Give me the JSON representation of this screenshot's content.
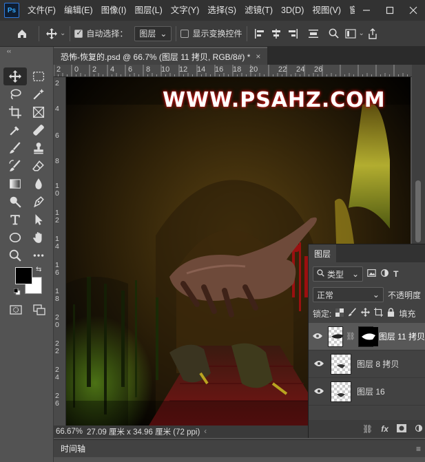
{
  "app": {
    "logo": "Ps"
  },
  "menu": [
    "文件(F)",
    "编辑(E)",
    "图像(I)",
    "图层(L)",
    "文字(Y)",
    "选择(S)",
    "滤镜(T)",
    "3D(D)",
    "视图(V)",
    "窗口"
  ],
  "options": {
    "auto_select_label": "自动选择：",
    "auto_select_target": "图层",
    "show_transform_label": "显示变换控件"
  },
  "document": {
    "tab_title": "恐怖-恢复的.psd @ 66.7% (图层 11 拷贝, RGB/8#) *",
    "close": "×"
  },
  "ruler_top": [
    "2",
    "0",
    "2",
    "4",
    "6",
    "8",
    "10",
    "12",
    "14",
    "16",
    "18",
    "20",
    "22",
    "24",
    "26"
  ],
  "ruler_left": [
    "2",
    "4",
    "6",
    "8",
    "1\n0",
    "1\n2",
    "1\n4",
    "1\n6",
    "1\n8",
    "2\n0",
    "2\n2",
    "2\n4",
    "2\n6"
  ],
  "canvas": {
    "watermark": "WWW.PSAHZ.COM"
  },
  "status": {
    "zoom": "66.67%",
    "size": "27.09 厘米 x 34.96 厘米 (72 ppi)"
  },
  "timeline": {
    "label": "时间轴"
  },
  "layers_panel": {
    "tab": "图层",
    "filter_kind": "类型",
    "blend_mode": "正常",
    "opacity_label": "不透明度",
    "lock_label": "锁定:",
    "fill_label": "填充",
    "layers": [
      {
        "name": "图层 11 拷贝",
        "selected": true,
        "has_mask": true
      },
      {
        "name": "图层 8 拷贝",
        "selected": false,
        "has_mask": false
      },
      {
        "name": "图层 16",
        "selected": false,
        "has_mask": false
      }
    ],
    "footer_fx": "fx"
  },
  "colors": {
    "foreground": "#000000",
    "background": "#ffffff",
    "accent": "#31a8ff"
  }
}
